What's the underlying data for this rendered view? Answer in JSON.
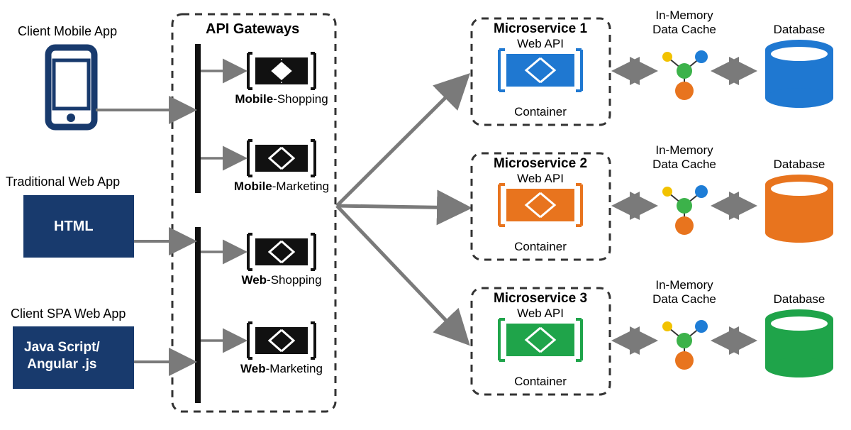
{
  "clients": {
    "mobile": {
      "label": "Client Mobile App"
    },
    "web": {
      "label": "Traditional Web App",
      "box_label": "HTML"
    },
    "spa": {
      "label": "Client SPA Web App",
      "box_label": "Java Script/\nAngular .js"
    }
  },
  "gateways": {
    "title": "API Gateways",
    "items": [
      {
        "bold": "Mobile",
        "rest": "-Shopping"
      },
      {
        "bold": "Mobile",
        "rest": "-Marketing"
      },
      {
        "bold": "Web",
        "rest": "-Shopping"
      },
      {
        "bold": "Web",
        "rest": "-Marketing"
      }
    ]
  },
  "microservices": {
    "items": [
      {
        "title": "Microservice 1",
        "api": "Web API",
        "container": "Container",
        "color": "#1f78d1"
      },
      {
        "title": "Microservice 2",
        "api": "Web API",
        "container": "Container",
        "color": "#e8741e"
      },
      {
        "title": "Microservice 3",
        "api": "Web API",
        "container": "Container",
        "color": "#1fa44a"
      }
    ]
  },
  "cache": {
    "label_top": "In-Memory",
    "label_bottom": "Data Cache"
  },
  "database": {
    "label": "Database"
  },
  "colors": {
    "navy": "#183a6d",
    "black": "#111",
    "arrow": "#7a7a7a",
    "cacheGreen": "#3cb24a",
    "cacheBlue": "#1e7dd6",
    "cacheOrange": "#e8741e",
    "cacheYellow": "#f2c200",
    "white": "#ffffff"
  }
}
